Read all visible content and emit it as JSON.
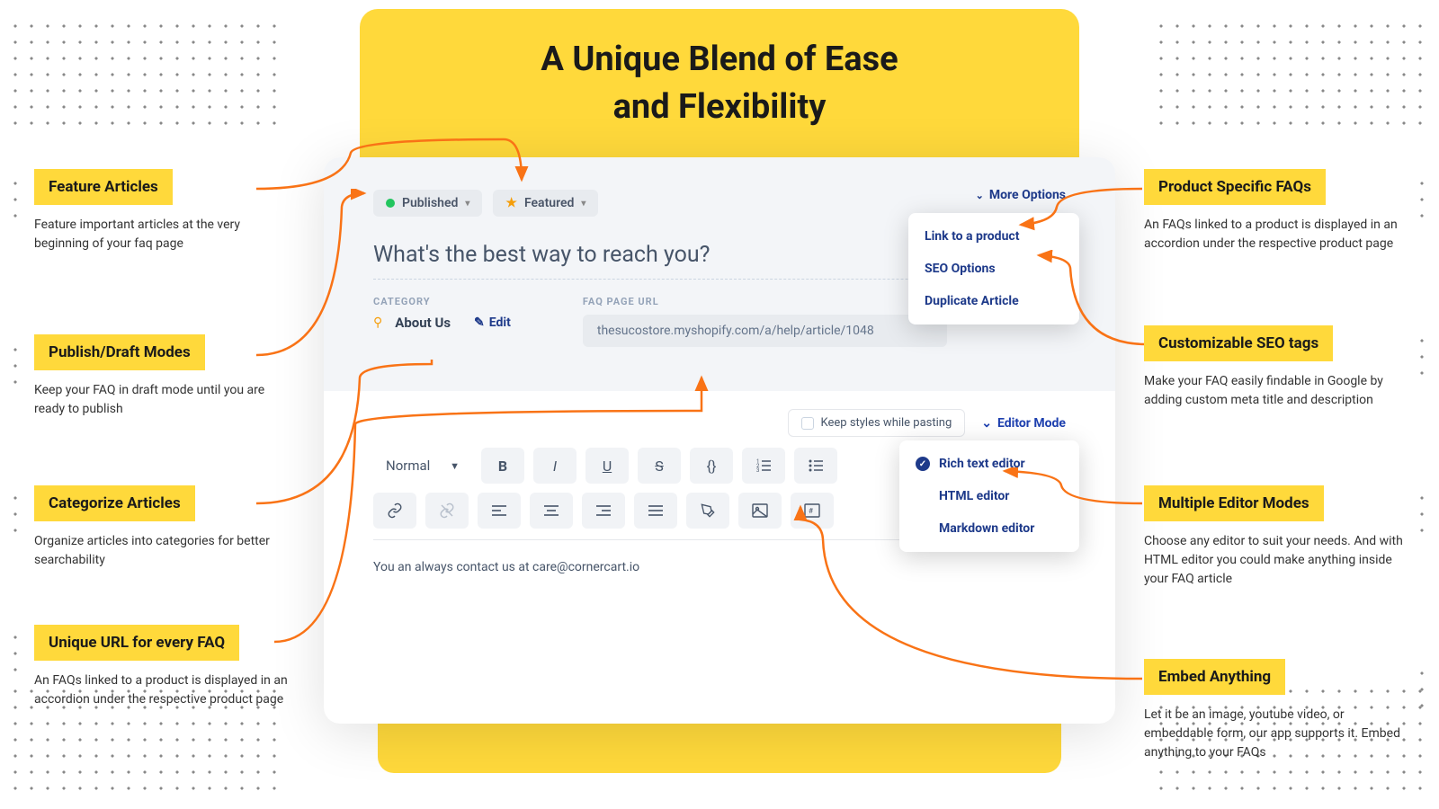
{
  "headline_l1": "A Unique Blend of Ease",
  "headline_l2": "and Flexibility",
  "card": {
    "published_label": "Published",
    "featured_label": "Featured",
    "more_options": "More Options",
    "dropdown": {
      "link": "Link to a product",
      "seo": "SEO Options",
      "dup": "Duplicate Article"
    },
    "question": "What's the best way to reach you?",
    "category_label": "CATEGORY",
    "category_value": "About Us",
    "edit_label": "Edit",
    "url_label": "FAQ PAGE URL",
    "url_value": "thesucostore.myshopify.com/a/help/article/1048",
    "keep_styles": "Keep styles while pasting",
    "editor_mode_label": "Editor Mode",
    "editors": {
      "rich": "Rich text editor",
      "html": "HTML editor",
      "md": "Markdown editor"
    },
    "normal": "Normal",
    "body": "You an always contact us at care@cornercart.io"
  },
  "left": {
    "c1": {
      "title": "Feature Articles",
      "desc": "Feature important articles at the very beginning of your faq page"
    },
    "c2": {
      "title": "Publish/Draft Modes",
      "desc": "Keep your FAQ in draft mode until you are ready to publish"
    },
    "c3": {
      "title": "Categorize Articles",
      "desc": "Organize articles into categories for better searchability"
    },
    "c4": {
      "title": "Unique URL for every FAQ",
      "desc": "An FAQs linked to a product is displayed in an accordion under the respective product page"
    }
  },
  "right": {
    "c1": {
      "title": "Product Specific FAQs",
      "desc": "An FAQs linked to a product is displayed in an accordion under the respective product page"
    },
    "c2": {
      "title": "Customizable SEO tags",
      "desc": "Make your FAQ easily findable in Google by adding custom meta title and description"
    },
    "c3": {
      "title": "Multiple Editor Modes",
      "desc": "Choose any editor to suit your needs. And with HTML editor you could make anything inside your FAQ article"
    },
    "c4": {
      "title": "Embed Anything",
      "desc": "Let it be an image, youtube video, or embeddable form, our app supports it. Embed anything to your FAQs"
    }
  }
}
